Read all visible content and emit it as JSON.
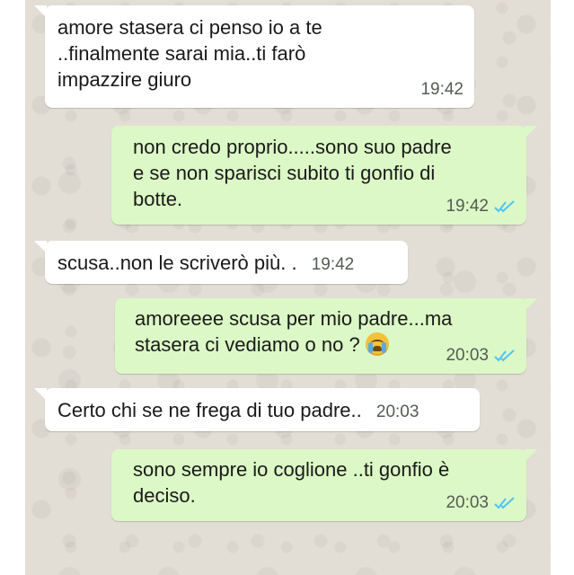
{
  "messages": [
    {
      "direction": "incoming",
      "text": "amore stasera ci penso io a te\n..finalmente sarai mia..ti farò\nimpazzire giuro",
      "time": "19:42"
    },
    {
      "direction": "outgoing",
      "text": "non credo proprio.....sono suo padre\ne se non sparisci subito ti gonfio di\nbotte.",
      "time": "19:42",
      "status_icon": "double-check-icon"
    },
    {
      "direction": "incoming",
      "text": "scusa..non le scriverò più. .",
      "time": "19:42"
    },
    {
      "direction": "outgoing",
      "text_line1": "amoreeee scusa per mio padre...ma",
      "text_line2": "stasera ci vediamo o no ?",
      "emoji": "crying-face-emoji",
      "time": "20:03",
      "status_icon": "double-check-icon"
    },
    {
      "direction": "incoming",
      "text": "Certo chi se ne frega di tuo padre..",
      "time": "20:03"
    },
    {
      "direction": "outgoing",
      "text": "sono sempre io coglione ..ti gonfio è\ndeciso.",
      "time": "20:03",
      "status_icon": "double-check-icon"
    }
  ],
  "colors": {
    "chat_background": "#e3ded5",
    "incoming_bubble": "#ffffff",
    "outgoing_bubble": "#dcf8c6",
    "read_ticks": "#4fc3f7",
    "timestamp": "#555b55"
  }
}
